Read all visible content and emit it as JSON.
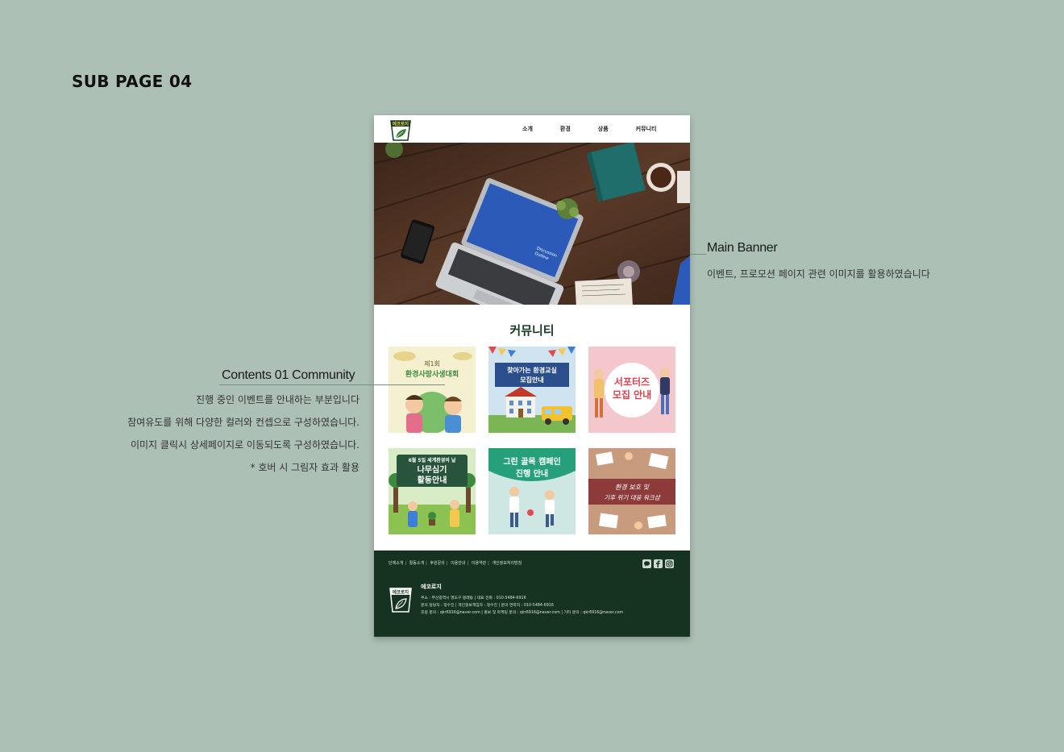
{
  "page_title": "SUB PAGE 04",
  "nav": [
    "소개",
    "환경",
    "상품",
    "커뮤니티"
  ],
  "logo_text": "에코로지",
  "section_title": "커뮤니티",
  "banner": {
    "screen_text_1": "Discussion",
    "screen_text_2": "Outline"
  },
  "cards": [
    {
      "line1": "제1회",
      "line2": "환경사랑사생대회"
    },
    {
      "line1": "찾아가는 환경교실",
      "line2": "모집안내"
    },
    {
      "line1": "서포터즈",
      "line2": "모집 안내"
    },
    {
      "line1": "6월 5일 세계환경의 날",
      "line2": "나무심기",
      "line3": "활동안내"
    },
    {
      "line1": "그린 골목 캠페인",
      "line2": "진행 안내"
    },
    {
      "line1": "환경 보호 및",
      "line2": "기후 위기 대응 워크샵"
    }
  ],
  "footer": {
    "links": [
      "단체소개",
      "활동소개",
      "후원문의",
      "이용안내",
      "이용약관",
      "개인정보처리방침"
    ],
    "brand": "에코로지",
    "info": [
      "주소 : 부산광역시 영도구 봉래동  |  대표 전화 : 010-5484-6916",
      "문의 담당자 : 정수진  |  개인정보책임자 : 정수진  |  문의 연락처 : 010-5484-6916",
      "후원 문의 : qkr6916@naver.com  |  홍보 및 마케팅 문의 : qkr6916@naver.com  |  기타 문의 : qkr6916@naver.com"
    ],
    "social": [
      "talk-icon",
      "facebook-icon",
      "instagram-icon"
    ]
  },
  "annotations": {
    "banner_title": "Main Banner",
    "banner_desc": "이벤트, 프로모션 페이지 관련 이미지를 활용하였습니다",
    "contents_title": "Contents 01 Community",
    "contents_desc": [
      "진행 중인 이벤트를 안내하는 부분입니다",
      "참여유도를 위해 다양한 컬러와 컨셉으로 구성하였습니다.",
      "이미지 클릭시 상세페이지로 이동되도록 구성하였습니다.",
      "* 호버 시 그림자 효과 활용"
    ]
  },
  "colors": {
    "background": "#adc0b6",
    "footer": "#163322",
    "brand_green": "#1a3a24"
  }
}
